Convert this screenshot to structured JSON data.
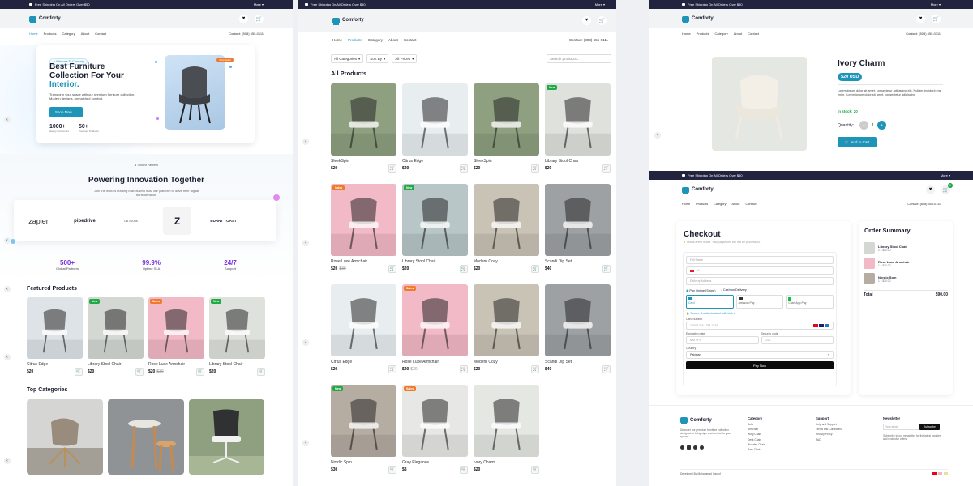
{
  "common": {
    "shipping": "Free Shipping On All Orders Over $50",
    "more": "More",
    "brand": "Comforty",
    "nav": [
      "Home",
      "Products",
      "Category",
      "About",
      "Contact"
    ],
    "contact": "Contact: (808) 555-0111"
  },
  "home": {
    "pill": "Welcome To Comforty",
    "hero_title_1": "Best Furniture",
    "hero_title_2": "Collection For Your",
    "hero_title_3": "Interior.",
    "hero_desc": "Transform your space with our premium furniture collection. Modern designs, unmatched comfort.",
    "shop_now": "Shop Now",
    "sale_badge": "Best Seller",
    "stats": [
      {
        "value": "1000+",
        "label": "Happy Customers"
      },
      {
        "value": "50+",
        "label": "Premium Products"
      }
    ],
    "partners_pill": "Trusted Partners",
    "partners_title": "Powering Innovation Together",
    "partners_desc": "Join the world's leading brands who trust our platform to drive their digital transformation",
    "partners": [
      "zapier",
      "pipedrive",
      "CB BANK",
      "Z",
      "BURNT TOAST"
    ],
    "metrics": [
      {
        "value": "500+",
        "label": "Global Partners"
      },
      {
        "value": "99.9%",
        "label": "Uptime SLA"
      },
      {
        "value": "24/7",
        "label": "Support"
      }
    ],
    "featured_title": "Featured Products",
    "featured": [
      {
        "name": "Citrus Edge",
        "price": "$20",
        "old": "",
        "tag": ""
      },
      {
        "name": "Library Stool Chair",
        "price": "$20",
        "old": "",
        "tag": "New"
      },
      {
        "name": "Rose Luxe Armchair",
        "price": "$20",
        "old": "$30",
        "tag": "Sales"
      },
      {
        "name": "Library Stool Chair",
        "price": "$20",
        "old": "",
        "tag": "New"
      }
    ],
    "categories_title": "Top Categories"
  },
  "products": {
    "filters": [
      "All Categories",
      "Sort By",
      "All Prices"
    ],
    "search_placeholder": "Search products...",
    "title": "All Products",
    "items": [
      {
        "name": "SleekSpin",
        "price": "$20",
        "old": "",
        "tag": "",
        "color": "#8ea07f"
      },
      {
        "name": "Citrus Edge",
        "price": "$20",
        "old": "",
        "tag": "",
        "color": "#e8eef0"
      },
      {
        "name": "SleekSpin",
        "price": "$20",
        "old": "",
        "tag": "",
        "color": "#8ea07f"
      },
      {
        "name": "Library Stool Chair",
        "price": "$20",
        "old": "",
        "tag": "New",
        "color": "#dfe1dd"
      },
      {
        "name": "Rose Luxe Armchair",
        "price": "$20",
        "old": "$30",
        "tag": "Sales",
        "color": "#f2b9c6"
      },
      {
        "name": "Library Stool Chair",
        "price": "$20",
        "old": "",
        "tag": "New",
        "color": "#b8c6c8"
      },
      {
        "name": "Modern Cozy",
        "price": "$20",
        "old": "",
        "tag": "",
        "color": "#c9c3b6"
      },
      {
        "name": "Scandi Dip Set",
        "price": "$40",
        "old": "",
        "tag": "",
        "color": "#9ea1a3"
      },
      {
        "name": "Citrus Edge",
        "price": "$20",
        "old": "",
        "tag": "",
        "color": "#e8eef0"
      },
      {
        "name": "Rose Luxe Armchair",
        "price": "$20",
        "old": "$30",
        "tag": "Sales",
        "color": "#f2b9c6"
      },
      {
        "name": "Modern Cozy",
        "price": "$20",
        "old": "",
        "tag": "",
        "color": "#c9c3b6"
      },
      {
        "name": "Scandi Dip Set",
        "price": "$40",
        "old": "",
        "tag": "",
        "color": "#9ea1a3"
      },
      {
        "name": "Nordic Spin",
        "price": "$30",
        "old": "",
        "tag": "New",
        "color": "#b5aca2"
      },
      {
        "name": "Gray Elegance",
        "price": "$8",
        "old": "",
        "tag": "Sales",
        "color": "#e7e7e5"
      },
      {
        "name": "Ivory Charm",
        "price": "$20",
        "old": "",
        "tag": "",
        "color": "#e4e7e2"
      }
    ]
  },
  "detail": {
    "name": "Ivory Charm",
    "price": "$20 USD",
    "desc": "Lorem ipsum dolor sit amet, consectetur adipiscing elit. Nullam tincidunt erat enim. Lorem ipsum dolor sit amet, consectetur adipiscing",
    "stock": "In stock: 20",
    "quantity_label": "Quantity:",
    "quantity": "1",
    "add_to_cart": "Add to Cart",
    "cart_count": "0"
  },
  "checkout": {
    "title": "Checkout",
    "demo_note": "This is a test mode. Your payments will not be processed.",
    "full_name": "Full Name",
    "phone": "+1",
    "address": "Delivery Address",
    "pay_online": "Pay Online (Stripe)",
    "cod": "Cash on Delivery",
    "methods": [
      "Card",
      "Amazon Pay",
      "Cash App Pay"
    ],
    "secure": "Secure, 1-click checkout with Link",
    "card_number_label": "Card number",
    "card_number_ph": "1234 1234 1234 1234",
    "exp_label": "Expiration date",
    "exp_ph": "MM / YY",
    "cvc_label": "Security code",
    "cvc_ph": "CVC",
    "country_label": "Country",
    "country": "Pakistan",
    "pay_now": "Pay Now",
    "summary_title": "Order Summary",
    "summary_items": [
      {
        "name": "Library Stool Chair",
        "qty": "2 x $20.00"
      },
      {
        "name": "Rose Luxe Armchair",
        "qty": "1 x $20.00"
      },
      {
        "name": "Nordic Spin",
        "qty": "1 x $30.00"
      }
    ],
    "total_label": "Total",
    "total": "$90.00"
  },
  "footer": {
    "desc": "Discover our premium furniture collection designed to bring style and comfort to your spaces.",
    "cols": [
      {
        "title": "Category",
        "items": [
          "Sofa",
          "Armchair",
          "Wing Chair",
          "Desk Chair",
          "Wooden Chair",
          "Park Chair"
        ]
      },
      {
        "title": "Support",
        "items": [
          "Help and Support",
          "Terms and Conditions",
          "Privacy Policy",
          "FAQ"
        ]
      }
    ],
    "newsletter_title": "Newsletter",
    "newsletter_ph": "Your email",
    "subscribe": "Subscribe",
    "newsletter_desc": "Subscribe to our newsletter for the latest updates and exclusive offers.",
    "developed": "Developed By Muhammad Yousuf"
  }
}
